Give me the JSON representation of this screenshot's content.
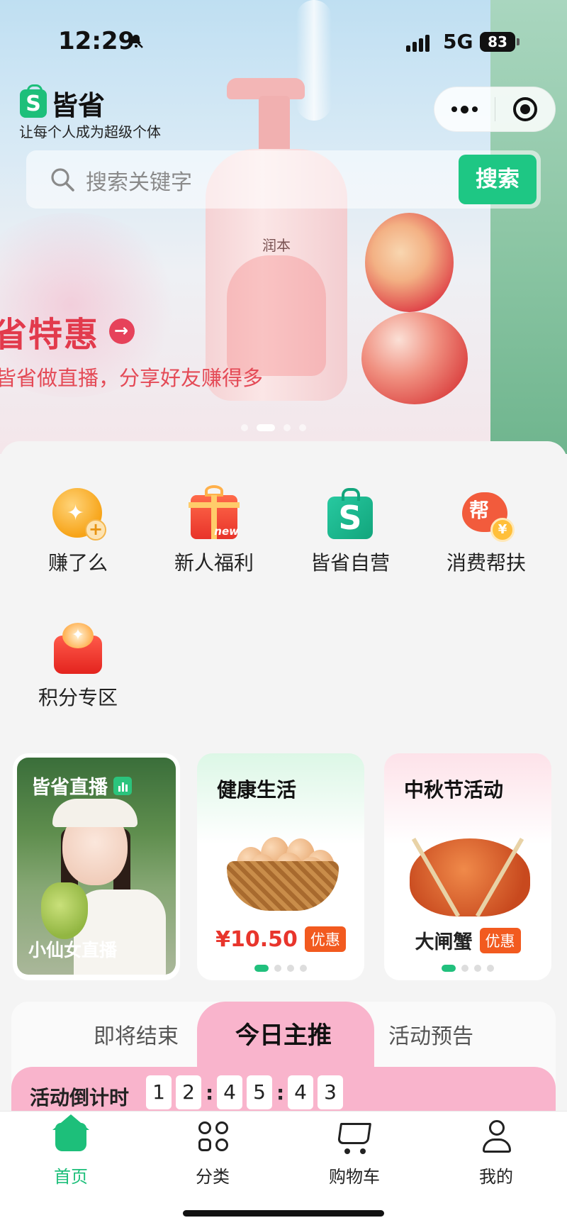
{
  "status_bar": {
    "time": "12:29",
    "network": "5G",
    "battery": "83"
  },
  "brand": {
    "logo_letter": "S",
    "name": "皆省",
    "slogan": "让每个人成为超级个体"
  },
  "search": {
    "placeholder": "搜索关键字",
    "button": "搜索"
  },
  "hero": {
    "bottle_brand": "润本",
    "title": "省特惠",
    "subtitle": "皆省做直播，分享好友赚得多",
    "dots": 4,
    "active_dot": 1
  },
  "quick_grid": [
    {
      "label": "赚了么",
      "icon": "earn-coin-icon"
    },
    {
      "label": "新人福利",
      "icon": "gift-box-icon",
      "badge": "new"
    },
    {
      "label": "皆省自营",
      "icon": "shopping-bag-icon",
      "letter": "S"
    },
    {
      "label": "消费帮扶",
      "icon": "help-heart-icon",
      "glyph": "帮",
      "coin": "¥"
    },
    {
      "label": "积分专区",
      "icon": "points-wallet-icon"
    }
  ],
  "cards": {
    "live": {
      "title": "皆省直播",
      "host": "小仙女直播"
    },
    "health": {
      "title": "健康生活",
      "price": "¥10.50",
      "tag": "优惠"
    },
    "festival": {
      "title": "中秋节活动",
      "product": "大闸蟹",
      "tag": "优惠"
    }
  },
  "tabs": {
    "left": "即将结束",
    "active": "今日主推",
    "right": "活动预告"
  },
  "countdown": {
    "label": "活动倒计时",
    "digits": [
      "1",
      "2",
      "4",
      "5",
      "4",
      "3"
    ]
  },
  "tabbar": [
    {
      "label": "首页",
      "active": true
    },
    {
      "label": "分类"
    },
    {
      "label": "购物车"
    },
    {
      "label": "我的"
    }
  ],
  "colors": {
    "accent": "#1dbf7a",
    "promo_red": "#e23a4c",
    "tag_orange": "#f25a1f",
    "tab_pink": "#f9b4cc"
  }
}
